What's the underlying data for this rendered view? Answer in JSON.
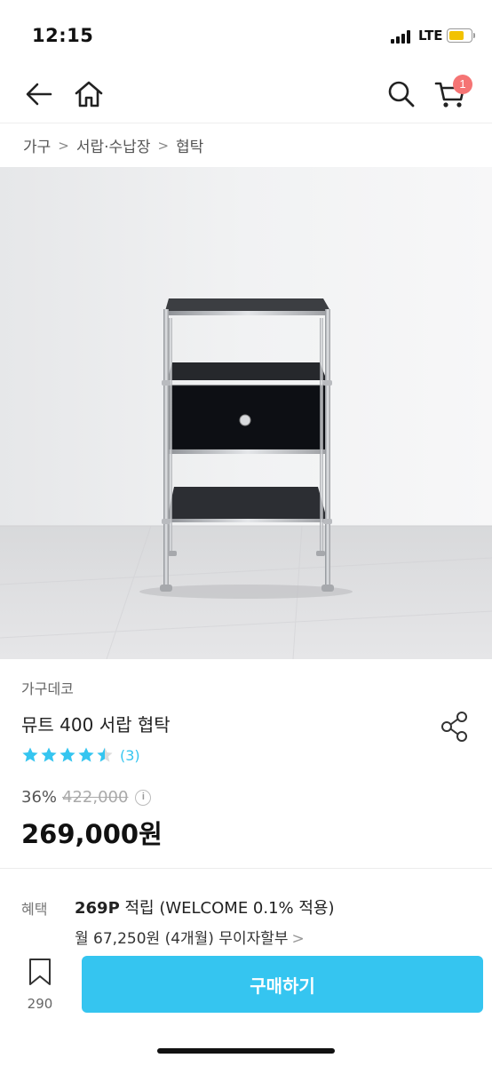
{
  "status_bar": {
    "time": "12:15",
    "network": "LTE"
  },
  "nav": {
    "cart_count": "1"
  },
  "breadcrumb": [
    "가구",
    "서랍·수납장",
    "협탁"
  ],
  "product": {
    "brand": "가구데코",
    "name": "뮤트 400 서랍 협탁",
    "rating": 4.5,
    "review_count": "(3)",
    "discount": "36%",
    "original_price": "422,000",
    "price": "269,000원"
  },
  "benefit": {
    "label": "혜택",
    "points": "269P",
    "points_text": " 적립 (WELCOME 0.1% 적용)",
    "installment": "월 67,250원 (4개월) 무이자할부"
  },
  "bottom_bar": {
    "scrap_count": "290",
    "buy_label": "구매하기"
  },
  "colors": {
    "accent": "#35c5f0",
    "badge": "#f57474"
  }
}
